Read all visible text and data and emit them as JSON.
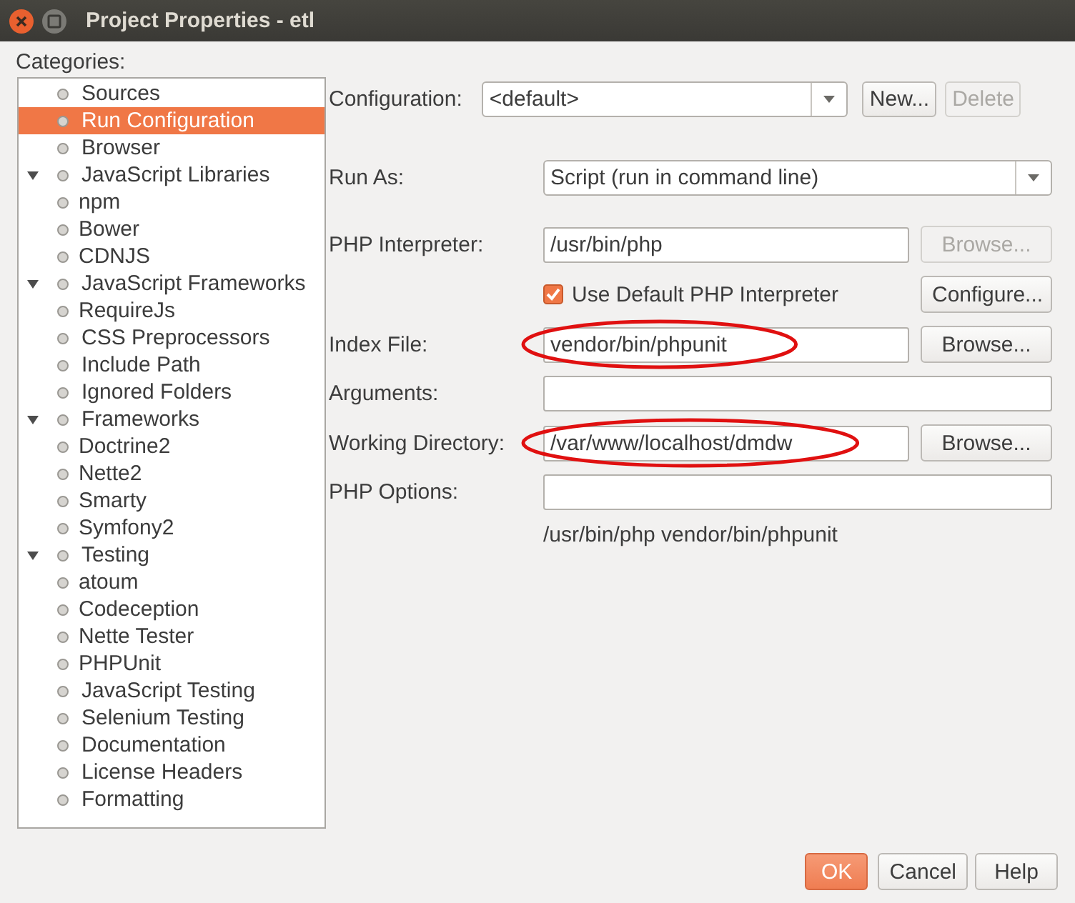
{
  "window": {
    "title": "Project Properties - etl"
  },
  "categories": {
    "label": "Categories:",
    "items": [
      {
        "label": "Sources",
        "selected": false
      },
      {
        "label": "Run Configuration",
        "selected": true
      },
      {
        "label": "Browser",
        "selected": false
      },
      {
        "label": "JavaScript Libraries",
        "selected": false,
        "expanded": true,
        "children": [
          {
            "label": "npm",
            "selected": false
          },
          {
            "label": "Bower",
            "selected": false
          },
          {
            "label": "CDNJS",
            "selected": false
          }
        ]
      },
      {
        "label": "JavaScript Frameworks",
        "selected": false,
        "expanded": true,
        "children": [
          {
            "label": "RequireJs",
            "selected": false
          }
        ]
      },
      {
        "label": "CSS Preprocessors",
        "selected": false
      },
      {
        "label": "Include Path",
        "selected": false
      },
      {
        "label": "Ignored Folders",
        "selected": false
      },
      {
        "label": "Frameworks",
        "selected": false,
        "expanded": true,
        "children": [
          {
            "label": "Doctrine2",
            "selected": false
          },
          {
            "label": "Nette2",
            "selected": false
          },
          {
            "label": "Smarty",
            "selected": false
          },
          {
            "label": "Symfony2",
            "selected": false
          }
        ]
      },
      {
        "label": "Testing",
        "selected": false,
        "expanded": true,
        "children": [
          {
            "label": "atoum",
            "selected": false
          },
          {
            "label": "Codeception",
            "selected": false
          },
          {
            "label": "Nette Tester",
            "selected": false
          },
          {
            "label": "PHPUnit",
            "selected": false
          }
        ]
      },
      {
        "label": "JavaScript Testing",
        "selected": false
      },
      {
        "label": "Selenium Testing",
        "selected": false
      },
      {
        "label": "Documentation",
        "selected": false
      },
      {
        "label": "License Headers",
        "selected": false
      },
      {
        "label": "Formatting",
        "selected": false
      }
    ]
  },
  "form": {
    "configuration": {
      "label": "Configuration:",
      "value": "<default>",
      "buttons": [
        {
          "label": "New...",
          "disabled": false
        },
        {
          "label": "Delete",
          "disabled": true
        }
      ]
    },
    "rows": [
      {
        "kind": "select",
        "label": "Run As:",
        "value": "Script (run in command line)"
      },
      {
        "kind": "field",
        "label": "PHP Interpreter:",
        "value": "/usr/bin/php",
        "circled": false,
        "button": {
          "label": "Browse...",
          "disabled": true
        }
      },
      {
        "kind": "checkbox",
        "label": "Use Default PHP Interpreter",
        "checked": true,
        "button": {
          "label": "Configure...",
          "disabled": false
        }
      },
      {
        "kind": "field",
        "label": "Index File:",
        "value": "vendor/bin/phpunit",
        "circled": true,
        "button": {
          "label": "Browse...",
          "disabled": false
        }
      },
      {
        "kind": "field",
        "label": "Arguments:",
        "circled": false
      },
      {
        "kind": "field",
        "label": "Working Directory:",
        "value": "/var/www/localhost/dmdw",
        "circled": true,
        "button": {
          "label": "Browse...",
          "disabled": false
        }
      },
      {
        "kind": "field",
        "label": "PHP Options:",
        "circled": false
      },
      {
        "kind": "note",
        "text": "/usr/bin/php vendor/bin/phpunit"
      }
    ]
  },
  "buttons": [
    {
      "label": "OK",
      "default": true
    },
    {
      "label": "Cancel",
      "default": false
    },
    {
      "label": "Help",
      "default": false
    }
  ]
}
